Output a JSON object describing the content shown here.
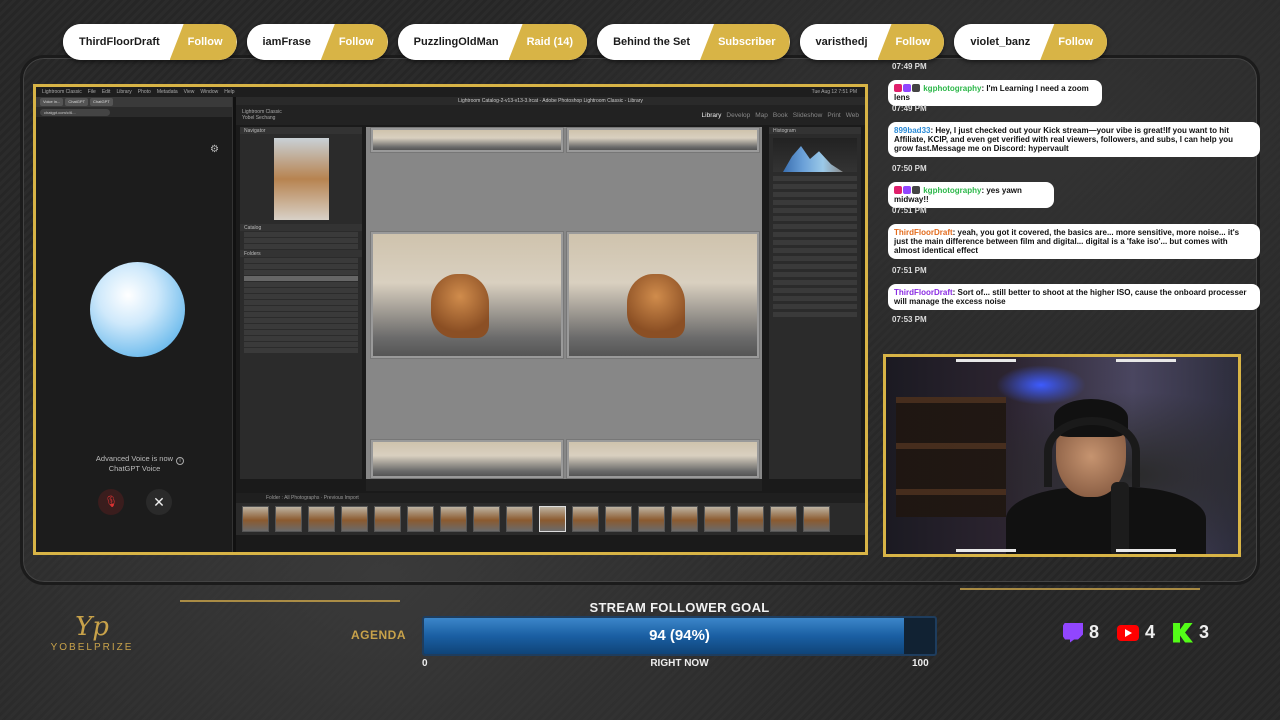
{
  "alerts": [
    {
      "name": "ThirdFloorDraft",
      "action": "Follow"
    },
    {
      "name": "iamFrase",
      "action": "Follow"
    },
    {
      "name": "PuzzlingOldMan",
      "action": "Raid (14)"
    },
    {
      "name": "Behind the Set",
      "action": "Subscriber"
    },
    {
      "name": "varisthedj",
      "action": "Follow"
    },
    {
      "name": "violet_banz",
      "action": "Follow"
    }
  ],
  "screen": {
    "menubar": [
      "Lightroom Classic",
      "File",
      "Edit",
      "Library",
      "Photo",
      "Metadata",
      "View",
      "Window",
      "Help"
    ],
    "clock": "Tue Aug 12 7:51 PM",
    "browser_tabs": [
      "Voice in...",
      "ChatGPT",
      "ChatGPT"
    ],
    "url": "chatgpt.com/c/6...",
    "voice_note_line1": "Advanced Voice is now",
    "voice_note_line2": "ChatGPT Voice",
    "lightroom_title": "Lightroom Catalog-2-v13-v13-3.lrcat - Adobe Photoshop Lightroom Classic - Library",
    "identity_line1": "Lightroom Classic",
    "identity_line2": "Yobel Sechang",
    "modules": [
      "Library",
      "Develop",
      "Map",
      "Book",
      "Slideshow",
      "Print",
      "Web"
    ],
    "left_panels": [
      "Navigator",
      "Catalog",
      "Folders"
    ],
    "right_panels": [
      "Histogram"
    ],
    "filmstrip_head": "Folder : All Photographs  ·  Previous Import"
  },
  "chat": {
    "messages": [
      {
        "time": "07:49 PM",
        "user": "kgphotography",
        "text": ": I'm Learning I need a zoom lens",
        "color": "green"
      },
      {
        "time": "07:49 PM",
        "user": "899bad33",
        "text": ": Hey, I just checked out your Kick stream—your vibe is great!If you want to hit Affiliate, KCIP, and even get verified with real viewers, followers, and subs, I can help you grow fast.Message me on Discord: hypervault",
        "color": "blue"
      },
      {
        "time": "07:50 PM",
        "user": "kgphotography",
        "text": ": yes yawn midway!!",
        "color": "green"
      },
      {
        "time": "07:51 PM",
        "user": "ThirdFloorDraft",
        "text": ": yeah, you got it covered, the basics are... more sensitive, more noise... it's just the main difference between film and digital... digital is a 'fake iso'... but comes with almost identical effect",
        "color": "orange"
      },
      {
        "time": "07:51 PM",
        "user": "ThirdFloorDraft",
        "text": ": Sort of... still better to shoot at the higher ISO, cause the onboard processer will manage the excess noise",
        "color": "orange"
      },
      {
        "time": "07:53 PM"
      }
    ]
  },
  "brand": {
    "logo": "Yp",
    "name": "YOBELPRIZE",
    "agenda": "AGENDA"
  },
  "goal": {
    "title": "STREAM FOLLOWER GOAL",
    "value_text": "94 (94%)",
    "progress": 0.94,
    "min": "0",
    "max": "100",
    "label": "RIGHT NOW"
  },
  "socials": {
    "twitch": "8",
    "youtube": "4",
    "kick": "3"
  },
  "colors": {
    "accent_gold": "#d8b446",
    "goal_blue": "#1a5fa3"
  }
}
